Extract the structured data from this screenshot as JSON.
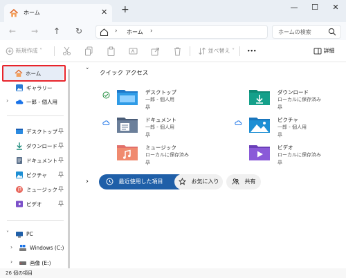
{
  "colors": {
    "accent": "#1f5fa8",
    "highlight_box": "#e8232a",
    "folder_blue": "#1d8fd4",
    "folder_teal": "#14a08a"
  },
  "tab": {
    "title": "ホーム",
    "close": "✕",
    "new_tab": "+"
  },
  "window_controls": {
    "minimize": "—",
    "maximize": "☐",
    "close": "✕"
  },
  "nav": {
    "back": "←",
    "forward": "→",
    "up": "↑",
    "refresh": "↻"
  },
  "address": {
    "separator": "›",
    "crumb": "ホーム"
  },
  "search": {
    "placeholder": "ホームの検索"
  },
  "toolbar": {
    "new_label": "新規作成",
    "new_arrow": "˅",
    "sort_label": "並べ替え",
    "sort_arrow": "˅",
    "more": "•••",
    "details_label": "詳細"
  },
  "sidebar": {
    "home": "ホーム",
    "gallery": "ギャラリー",
    "onedrive": "一郎 - 個人用",
    "pinned": [
      "デスクトップ",
      "ダウンロード",
      "ドキュメント",
      "ピクチャ",
      "ミュージック",
      "ビデオ"
    ],
    "pc": "PC",
    "drive_c": "Windows (C:)",
    "drive_e": "画像 (E:)"
  },
  "quick_access": {
    "title": "クイック アクセス",
    "items": [
      {
        "name": "デスクトップ",
        "sub": "一郎 - 個人用",
        "icon": "desktop-folder-icon",
        "status": "synced-check-icon"
      },
      {
        "name": "ダウンロード",
        "sub": "ローカルに保存済み",
        "icon": "downloads-folder-icon",
        "status": ""
      },
      {
        "name": "ドキュメント",
        "sub": "一郎 - 個人用",
        "icon": "documents-folder-icon",
        "status": "cloud-icon"
      },
      {
        "name": "ピクチャ",
        "sub": "一郎 - 個人用",
        "icon": "pictures-folder-icon",
        "status": "cloud-icon"
      },
      {
        "name": "ミュージック",
        "sub": "ローカルに保存済み",
        "icon": "music-folder-icon",
        "status": ""
      },
      {
        "name": "ビデオ",
        "sub": "ローカルに保存済み",
        "icon": "videos-folder-icon",
        "status": ""
      }
    ]
  },
  "filters": {
    "collapse": "›",
    "recent": "最近使用した項目",
    "favorites": "お気に入り",
    "shared": "共有"
  },
  "status": {
    "count": "26 個の項目"
  }
}
